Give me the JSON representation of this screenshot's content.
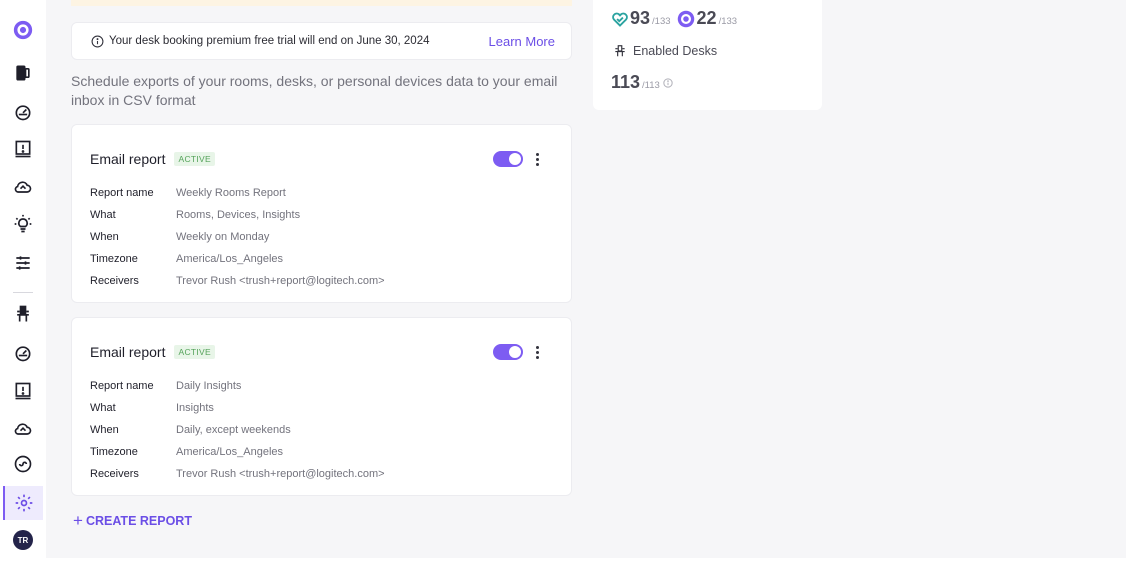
{
  "banner": {
    "text": "Your desk booking premium free trial will end on June 30, 2024",
    "link": "Learn More"
  },
  "description": "Schedule exports of your rooms, desks, or personal devices data to your email inbox in CSV format",
  "reports": [
    {
      "title": "Email report",
      "status": "ACTIVE",
      "enabled": true,
      "fields": [
        {
          "label": "Report name",
          "value": "Weekly Rooms Report"
        },
        {
          "label": "What",
          "value": "Rooms, Devices, Insights"
        },
        {
          "label": "When",
          "value": "Weekly on Monday"
        },
        {
          "label": "Timezone",
          "value": "America/Los_Angeles"
        },
        {
          "label": "Receivers",
          "value": "Trevor Rush <trush+report@logitech.com>"
        }
      ]
    },
    {
      "title": "Email report",
      "status": "ACTIVE",
      "enabled": true,
      "fields": [
        {
          "label": "Report name",
          "value": "Daily Insights"
        },
        {
          "label": "What",
          "value": "Insights"
        },
        {
          "label": "When",
          "value": "Daily, except weekends"
        },
        {
          "label": "Timezone",
          "value": "America/Los_Angeles"
        },
        {
          "label": "Receivers",
          "value": "Trevor Rush <trush+report@logitech.com>"
        }
      ]
    }
  ],
  "create_report": "CREATE REPORT",
  "stats": {
    "healthy": "93",
    "healthy_total": "/133",
    "synced": "22",
    "synced_total": "/133",
    "enabled_label": "Enabled Desks",
    "enabled": "113",
    "enabled_total": "/113"
  },
  "user": {
    "initials": "TR"
  },
  "sidebar": {
    "items": [
      "logo-icon",
      "devices-icon",
      "dashboard-icon",
      "alerts-icon",
      "cloud-icon",
      "insights-icon",
      "settings-sliders-icon",
      "desk-icon",
      "dashboard-icon-2",
      "alerts-icon-2",
      "cloud-icon-2",
      "integrations-icon",
      "gear-icon"
    ],
    "active": "gear-icon"
  },
  "colors": {
    "accent": "#7d5cf2",
    "link": "#6b4ee6",
    "active_badge": "#55a35a",
    "health": "#2aa3a0"
  }
}
